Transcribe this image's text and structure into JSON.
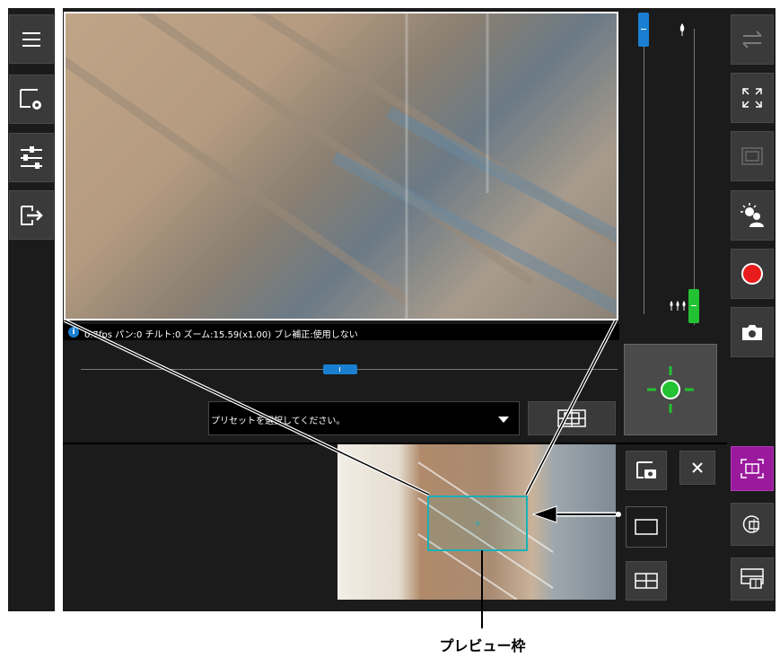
{
  "status_bar": {
    "text": "0.7fps パン:0 チルト:0 ズーム:15.59(x1.00) ブレ補正:使用しない"
  },
  "preset": {
    "placeholder": "プリセットを選択してください。"
  },
  "annotation": {
    "label": "プレビュー枠"
  },
  "zoom_slider": {
    "position": 0.0
  },
  "focus_slider": {
    "position": 1.0
  },
  "pan_slider": {
    "position": 0.48
  },
  "colors": {
    "background": "#1b1b1b",
    "button": "#3a3a3a",
    "accent_blue": "#1a7fd0",
    "accent_green": "#22c232",
    "record_red": "#e81c1c",
    "active_purple": "#9a1a9e",
    "preview_frame": "#1ab0b8"
  },
  "icons": {
    "left_toolbar": [
      "menu-icon",
      "camera-settings-icon",
      "image-adjust-icon",
      "exit-icon"
    ],
    "right_toolbar": [
      "swap-icon",
      "fullscreen-icon",
      "frame-icon",
      "backlight-icon",
      "record-icon",
      "snapshot-icon",
      "panorama-preview-icon",
      "rotate-preview-icon",
      "preview-display-icon"
    ]
  }
}
